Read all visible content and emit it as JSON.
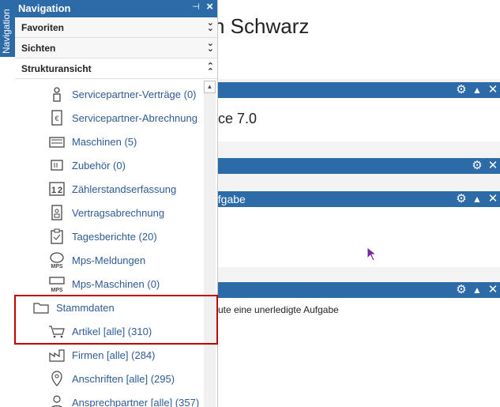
{
  "side_tab": {
    "label": "Navigation"
  },
  "main": {
    "title": "n Schwarz",
    "panels": [
      {
        "bar_text": "",
        "body_text": "ce 7.0"
      },
      {
        "bar_text": "",
        "body_text": ""
      },
      {
        "bar_text": "ufgabe",
        "body_text": ""
      },
      {
        "bar_text": "",
        "body_text": "ute eine unerledigte Aufgabe"
      }
    ]
  },
  "nav": {
    "title": "Navigation",
    "sections": [
      {
        "label": "Favoriten"
      },
      {
        "label": "Sichten"
      },
      {
        "label": "Strukturansicht"
      }
    ],
    "items": [
      {
        "label": "Servicepartner-Verträge (0)",
        "icon": "person-tag-icon"
      },
      {
        "label": "Servicepartner-Abrechnung",
        "icon": "euro-document-icon"
      },
      {
        "label": "Maschinen (5)",
        "icon": "machine-icon"
      },
      {
        "label": "Zubehör (0)",
        "icon": "accessory-icon"
      },
      {
        "label": "Zählerstandserfassung",
        "icon": "counter-icon"
      },
      {
        "label": "Vertragsabrechnung",
        "icon": "contract-billing-icon"
      },
      {
        "label": "Tagesberichte (20)",
        "icon": "clipboard-icon"
      },
      {
        "label": "Mps-Meldungen",
        "icon": "mps-message-icon"
      },
      {
        "label": "Mps-Maschinen (0)",
        "icon": "mps-machine-icon"
      },
      {
        "label": "Stammdaten",
        "icon": "folder-icon"
      },
      {
        "label": "Artikel [alle] (310)",
        "icon": "cart-icon"
      },
      {
        "label": "Firmen [alle] (284)",
        "icon": "factory-icon"
      },
      {
        "label": "Anschriften [alle] (295)",
        "icon": "location-pin-icon"
      },
      {
        "label": "Ansprechpartner [alle] (357)",
        "icon": "person-icon"
      }
    ]
  },
  "colors": {
    "accent": "#2d6aa8",
    "link": "#2d5b96",
    "highlight": "#c00000"
  }
}
